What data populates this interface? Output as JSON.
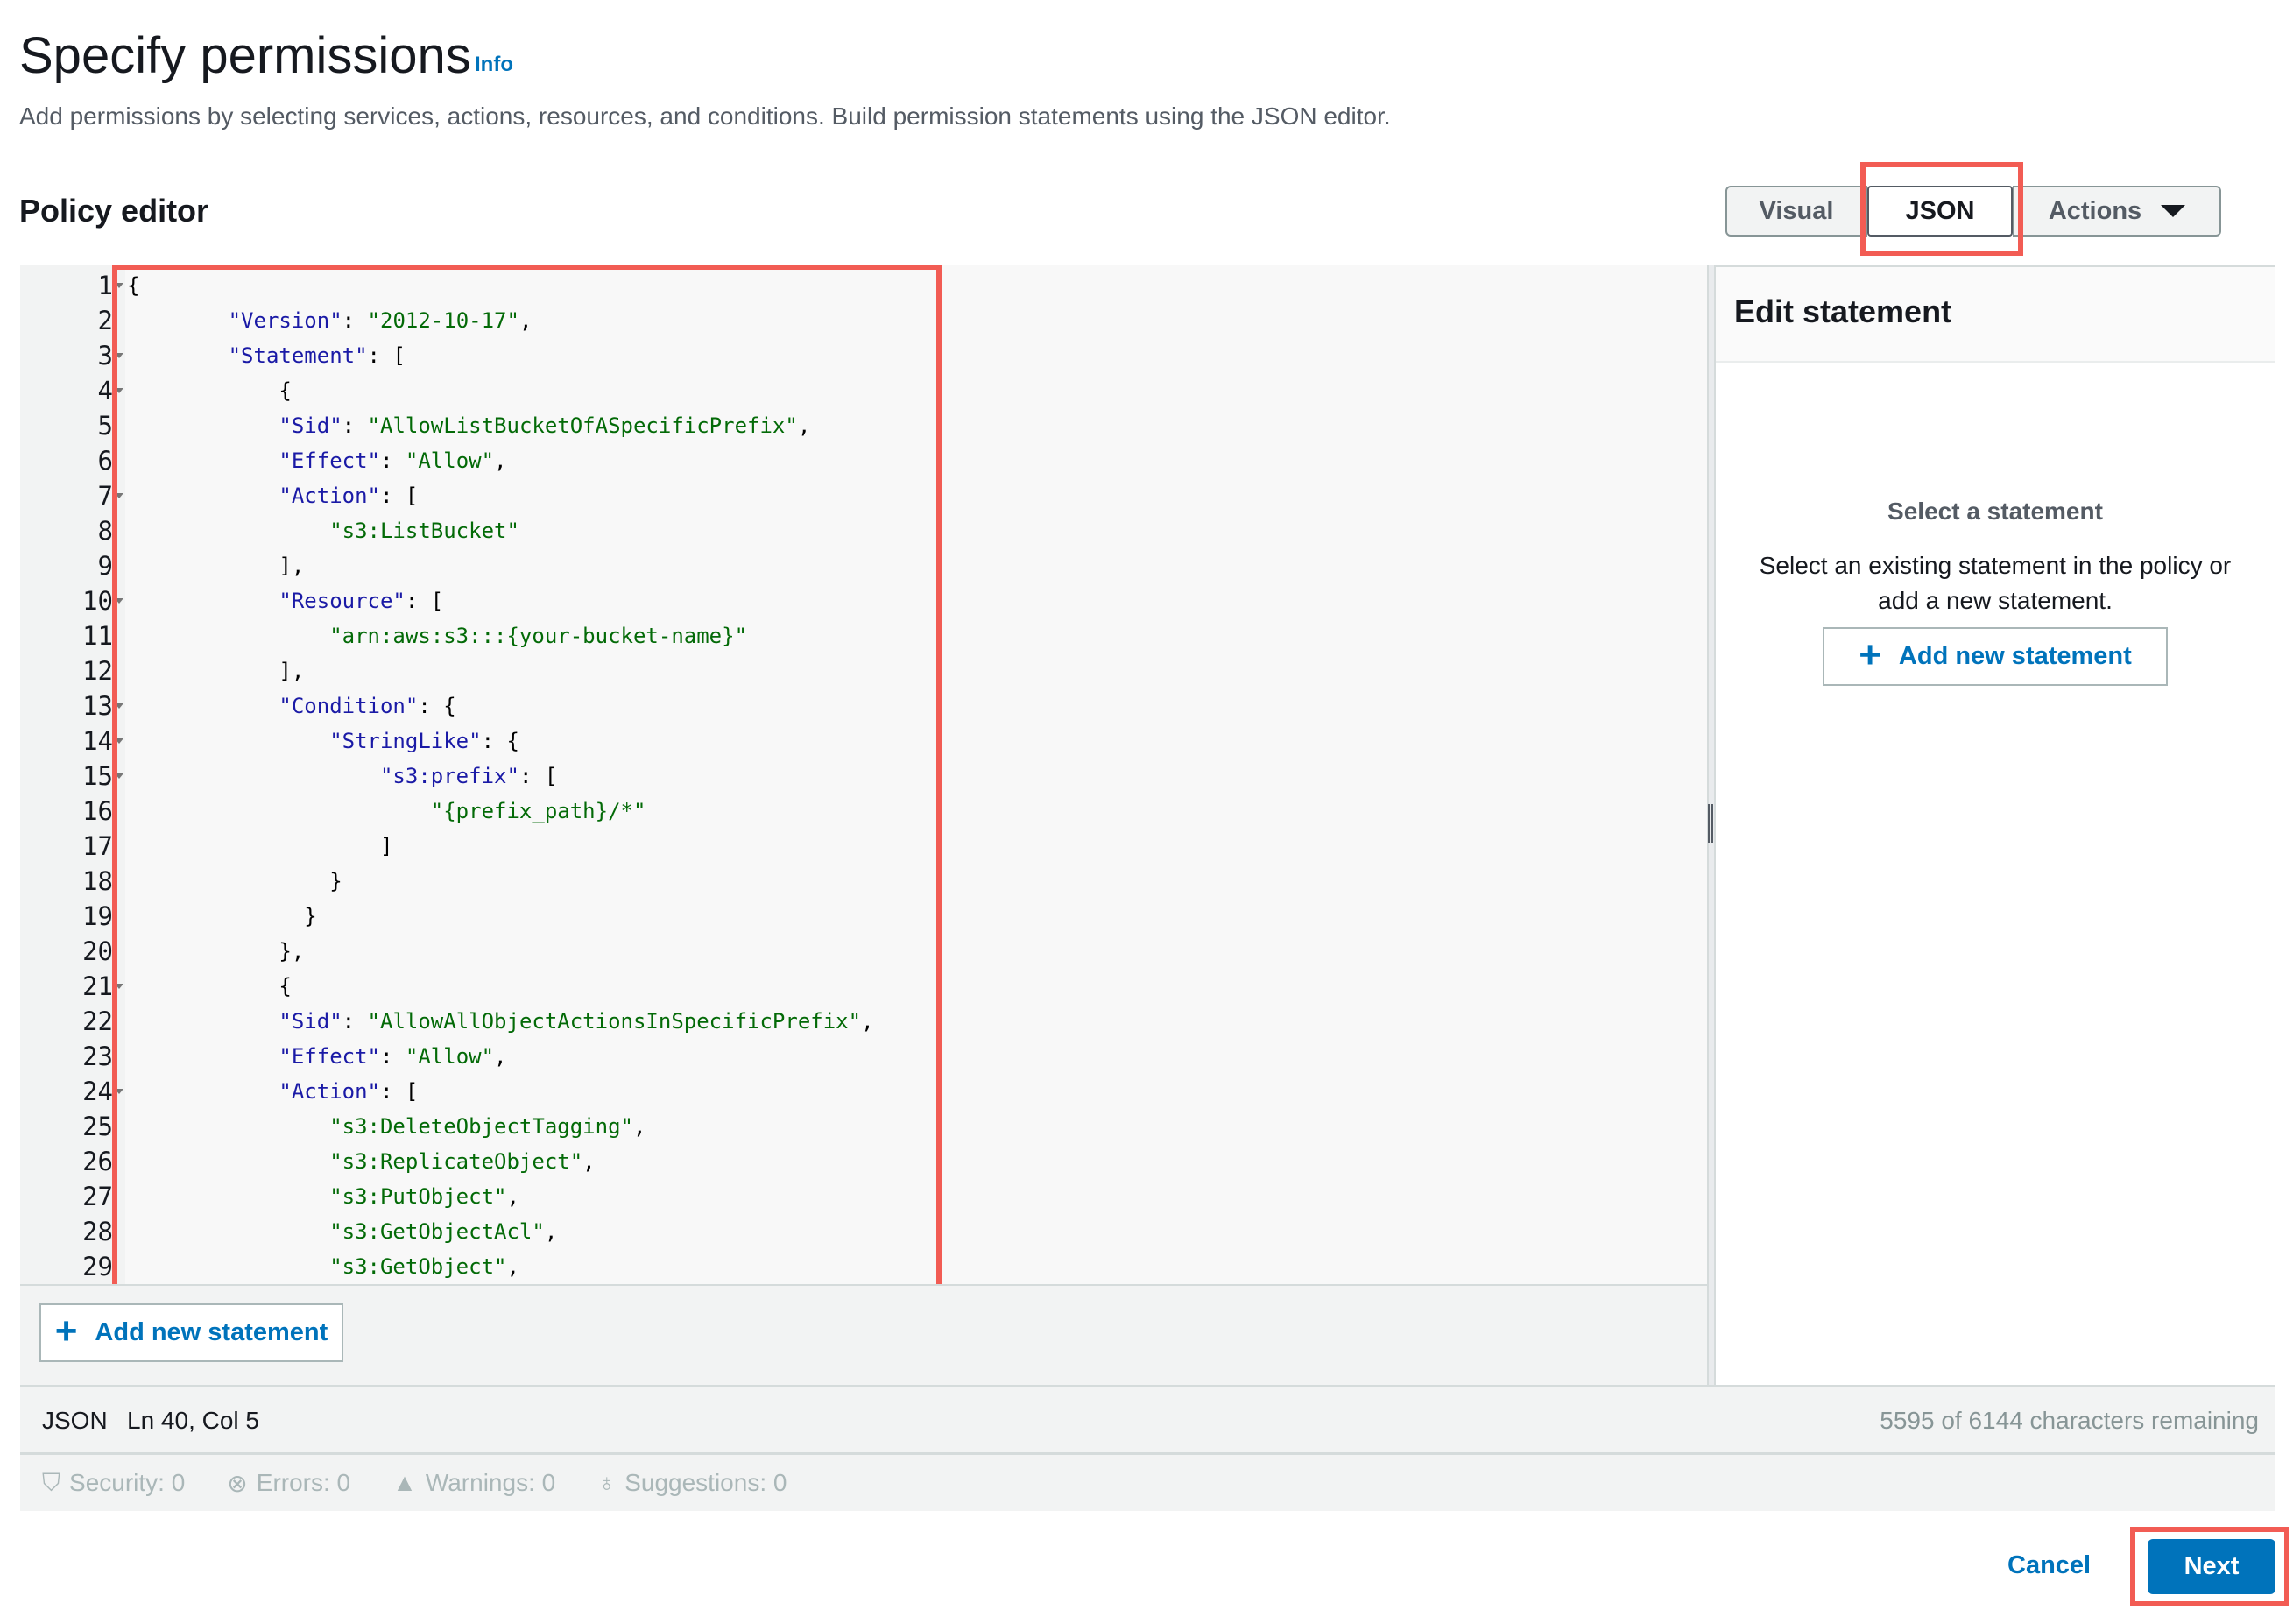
{
  "header": {
    "title": "Specify permissions",
    "info_link": "Info",
    "subtitle": "Add permissions by selecting services, actions, resources, and conditions. Build permission statements using the JSON editor."
  },
  "policy_editor": {
    "title": "Policy editor",
    "tabs": [
      {
        "label": "Visual",
        "selected": false
      },
      {
        "label": "JSON",
        "selected": true
      }
    ],
    "actions_label": "Actions",
    "highlight_color": "#f25c54",
    "code_lines": [
      "{",
      "        \"Version\": \"2012-10-17\",",
      "        \"Statement\": [",
      "            {",
      "            \"Sid\": \"AllowListBucketOfASpecificPrefix\",",
      "            \"Effect\": \"Allow\",",
      "            \"Action\": [",
      "                \"s3:ListBucket\"",
      "            ],",
      "            \"Resource\": [",
      "                \"arn:aws:s3:::{your-bucket-name}\"",
      "            ],",
      "            \"Condition\": {",
      "                \"StringLike\": {",
      "                    \"s3:prefix\": [",
      "                        \"{prefix_path}/*\"",
      "                    ]",
      "                }",
      "              }",
      "            },",
      "            {",
      "            \"Sid\": \"AllowAllObjectActionsInSpecificPrefix\",",
      "            \"Effect\": \"Allow\",",
      "            \"Action\": [",
      "                \"s3:DeleteObjectTagging\",",
      "                \"s3:ReplicateObject\",",
      "                \"s3:PutObject\",",
      "                \"s3:GetObjectAcl\",",
      "                \"s3:GetObject\","
    ],
    "foldable_lines": [
      1,
      3,
      4,
      7,
      10,
      13,
      14,
      15,
      21,
      24
    ],
    "add_statement_label": "Add new statement",
    "status": {
      "mode": "JSON",
      "position": "Ln 40, Col 5",
      "remaining": "5595 of 6144 characters remaining"
    },
    "problems": [
      {
        "icon": "shield-icon",
        "label": "Security: 0"
      },
      {
        "icon": "error-icon",
        "label": "Errors: 0"
      },
      {
        "icon": "warning-icon",
        "label": "Warnings: 0"
      },
      {
        "icon": "lightbulb-icon",
        "label": "Suggestions: 0"
      }
    ]
  },
  "edit_statement": {
    "title": "Edit statement",
    "empty_title": "Select a statement",
    "empty_desc": "Select an existing statement in the policy or add a new statement.",
    "add_label": "Add new statement"
  },
  "footer": {
    "cancel": "Cancel",
    "next": "Next"
  }
}
